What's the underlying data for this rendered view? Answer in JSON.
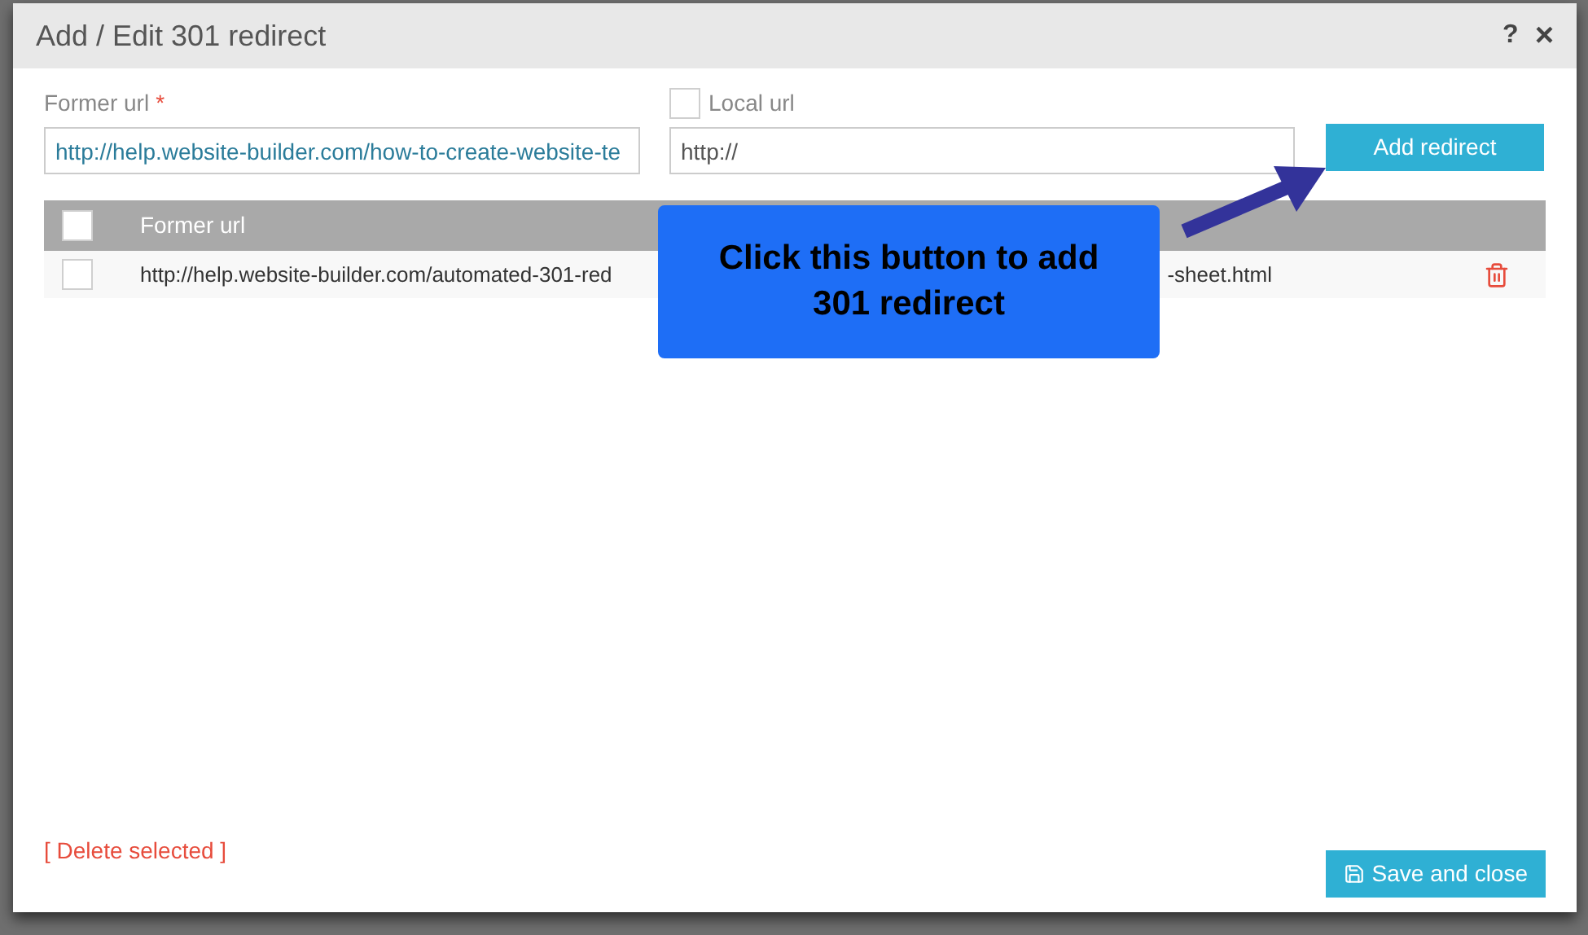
{
  "dialog": {
    "title": "Add / Edit 301 redirect",
    "help": "?",
    "close": "×"
  },
  "form": {
    "former_url": {
      "label": "Former url",
      "required_mark": "*",
      "value": "http://help.website-builder.com/how-to-create-website-te"
    },
    "local_url": {
      "label": "Local url",
      "checked": false,
      "value": "http://"
    },
    "add_button": "Add redirect"
  },
  "table": {
    "header_checked": false,
    "columns": [
      "Former url"
    ],
    "rows": [
      {
        "checked": false,
        "former_url": "http://help.website-builder.com/automated-301-red",
        "new_url": "-sheet.html"
      }
    ]
  },
  "callout": {
    "text": "Click this button to add 301 redirect"
  },
  "footer": {
    "delete_link": "[ Delete selected ]",
    "save_button": "Save and close"
  }
}
